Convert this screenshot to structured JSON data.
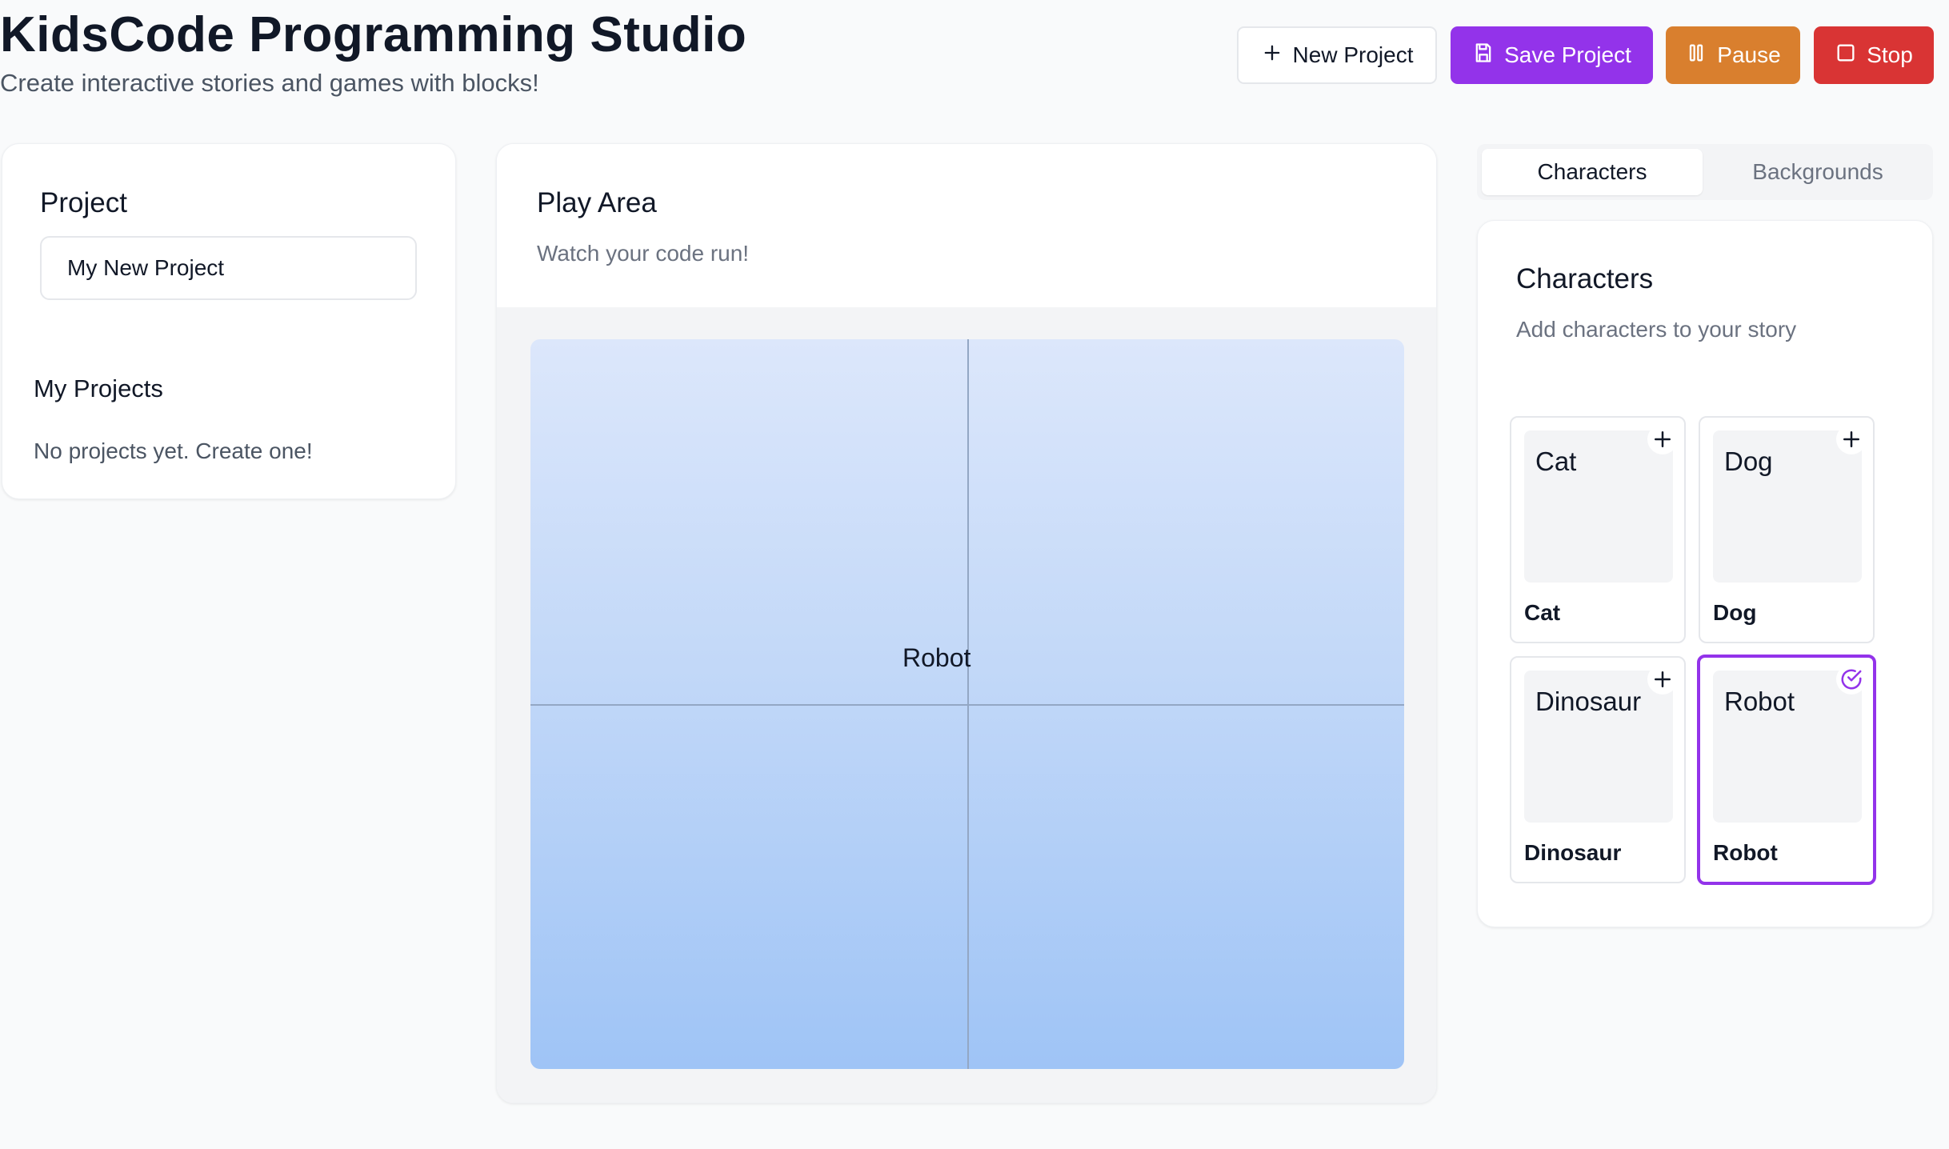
{
  "header": {
    "title": "KidsCode Programming Studio",
    "subtitle": "Create interactive stories and games with blocks!"
  },
  "toolbar": {
    "new_project_label": "New Project",
    "save_project_label": "Save Project",
    "pause_label": "Pause",
    "stop_label": "Stop"
  },
  "left_panel": {
    "project_heading": "Project",
    "project_name_value": "My New Project",
    "my_projects_heading": "My Projects",
    "empty_message": "No projects yet. Create one!"
  },
  "play_area": {
    "title": "Play Area",
    "subtitle": "Watch your code run!",
    "sprite_label": "Robot"
  },
  "right_panel": {
    "tabs": [
      {
        "label": "Characters",
        "active": true
      },
      {
        "label": "Backgrounds",
        "active": false
      }
    ],
    "title": "Characters",
    "subtitle": "Add characters to your story",
    "characters": [
      {
        "name": "Cat",
        "label": "Cat",
        "selected": false,
        "icon": "plus-icon"
      },
      {
        "name": "Dog",
        "label": "Dog",
        "selected": false,
        "icon": "plus-icon"
      },
      {
        "name": "Dinosaur",
        "label": "Dinosaur",
        "selected": false,
        "icon": "plus-icon"
      },
      {
        "name": "Robot",
        "label": "Robot",
        "selected": true,
        "icon": "check-circle-icon"
      }
    ]
  },
  "colors": {
    "accent_purple": "#9333ea",
    "pause_orange": "#d97f2e",
    "stop_red": "#d93434",
    "stage_top": "#dce7fb",
    "stage_bottom": "#9fc4f6"
  }
}
